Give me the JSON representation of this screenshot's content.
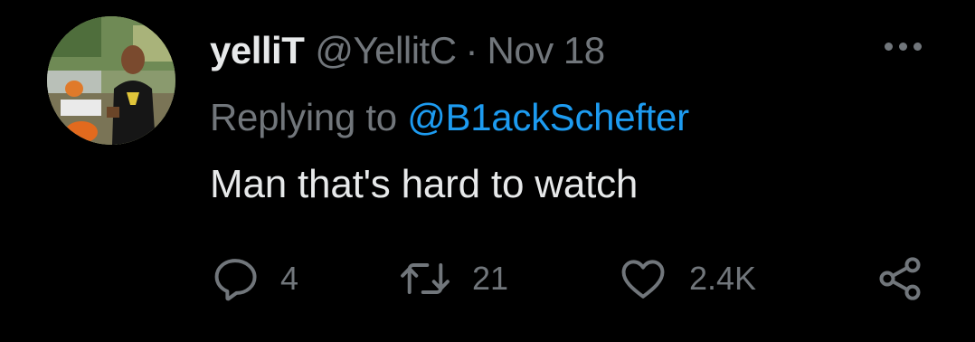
{
  "tweet": {
    "author": {
      "display_name": "yelliT",
      "handle": "@YellitC",
      "separator": "·",
      "date": "Nov 18",
      "avatar_icon": "profile-photo"
    },
    "replying": {
      "prefix": "Replying to",
      "mention": "@B1ackSchefter"
    },
    "text": "Man that's hard to watch",
    "actions": {
      "reply": {
        "icon": "reply-icon",
        "count": "4"
      },
      "retweet": {
        "icon": "retweet-icon",
        "count": "21"
      },
      "like": {
        "icon": "heart-icon",
        "count": "2.4K"
      },
      "share": {
        "icon": "share-icon"
      }
    },
    "more_icon": "more-options-icon"
  },
  "colors": {
    "background": "#000000",
    "primary_text": "#e7e9ea",
    "secondary_text": "#71767b",
    "link": "#1d9bf0"
  }
}
